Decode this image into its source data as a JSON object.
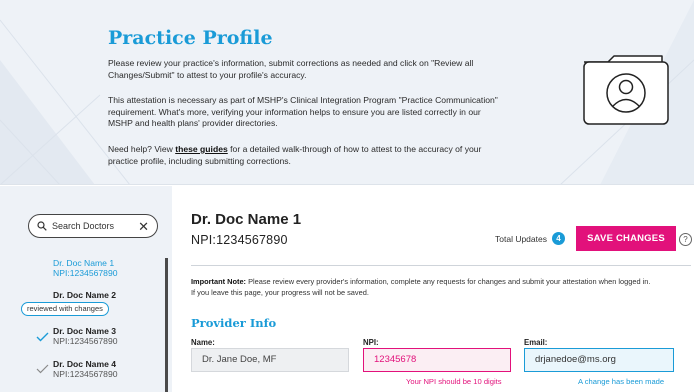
{
  "header": {
    "title": "Practice Profile",
    "para1": "Please review your practice's information, submit corrections as needed and click on \"Review all Changes/Submit\" to attest to your profile's accuracy.",
    "para2": "This attestation is necessary as part of MSHP's Clinical Integration Program \"Practice Communication\" requirement. What's more, verifying your information helps to ensure you are listed correctly in our MSHP and health plans' provider directories.",
    "para3_before": "Need help? View ",
    "para3_link": "these guides",
    "para3_after": " for a detailed walk-through of how to attest to the accuracy of your practice profile, including submitting corrections.",
    "illustration_icon": "folder-profile-icon"
  },
  "sidebar": {
    "search_placeholder": "Search Doctors",
    "reviewed_label": "reviewed with changes",
    "doctors": [
      {
        "name": "Dr. Doc Name 1",
        "npi": "NPI:1234567890",
        "active": true,
        "reviewed": false
      },
      {
        "name": "Dr. Doc Name 2",
        "npi": "",
        "active": false,
        "reviewed": false
      },
      {
        "name": "Dr. Doc Name 3",
        "npi": "NPI:1234567890",
        "active": false,
        "reviewed": true
      },
      {
        "name": "Dr. Doc Name 4",
        "npi": "NPI:1234567890",
        "active": false,
        "reviewed": true
      }
    ]
  },
  "main": {
    "doctor_name": "Dr. Doc Name 1",
    "doctor_npi": "NPI:1234567890",
    "total_updates_label": "Total Updates",
    "total_updates_count": "4",
    "save_label": "SAVE CHANGES",
    "help_label": "?",
    "note_bold": "Important Note:",
    "note_text": " Please review every provider's information, complete any requests for changes and submit your attestation when logged in. If you leave this page, your progress will not be saved.",
    "section_title": "Provider Info",
    "fields": {
      "name_label": "Name:",
      "name_value": "Dr. Jane Doe, MF",
      "npi_label": "NPI:",
      "npi_value": "12345678",
      "npi_error": "Your NPI should be 10 digits",
      "email_label": "Email:",
      "email_value": "drjanedoe@ms.org",
      "email_info": "A change has been made"
    }
  },
  "colors": {
    "accent_blue": "#1a9bd7",
    "accent_pink": "#e2117b",
    "panel_bg": "#eef2f7"
  }
}
